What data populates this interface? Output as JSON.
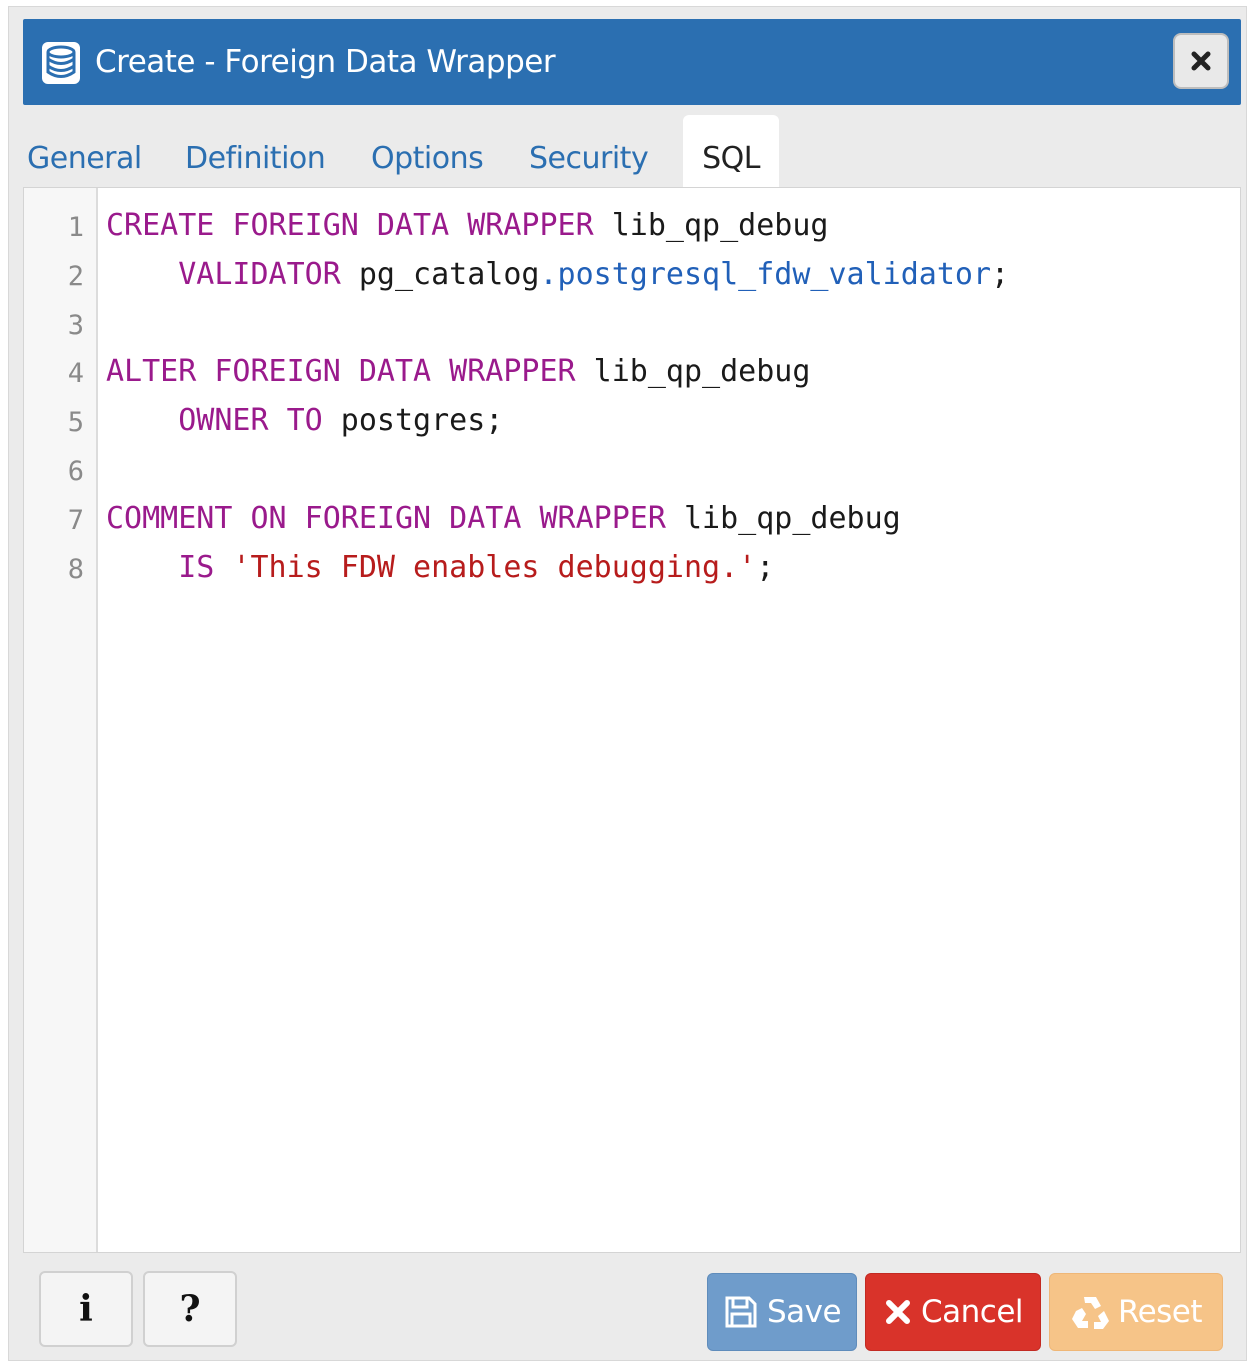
{
  "dialog": {
    "title": "Create - Foreign Data Wrapper",
    "title_icon": "database-icon",
    "close_icon": "close-icon"
  },
  "tabs": [
    {
      "label": "General",
      "active": false
    },
    {
      "label": "Definition",
      "active": false
    },
    {
      "label": "Options",
      "active": false
    },
    {
      "label": "Security",
      "active": false
    },
    {
      "label": "SQL",
      "active": true
    }
  ],
  "editor": {
    "line_numbers": [
      "1",
      "2",
      "3",
      "4",
      "5",
      "6",
      "7",
      "8"
    ],
    "lines": [
      [
        {
          "t": "CREATE FOREIGN DATA WRAPPER",
          "c": "kw"
        },
        {
          "t": " lib_qp_debug",
          "c": ""
        }
      ],
      [
        {
          "t": "    ",
          "c": ""
        },
        {
          "t": "VALIDATOR",
          "c": "kw"
        },
        {
          "t": " pg_catalog",
          "c": ""
        },
        {
          "t": ".postgresql_fdw_validator",
          "c": "fn"
        },
        {
          "t": ";",
          "c": ""
        }
      ],
      [],
      [
        {
          "t": "ALTER FOREIGN DATA WRAPPER",
          "c": "kw"
        },
        {
          "t": " lib_qp_debug",
          "c": ""
        }
      ],
      [
        {
          "t": "    ",
          "c": ""
        },
        {
          "t": "OWNER TO",
          "c": "kw"
        },
        {
          "t": " postgres;",
          "c": ""
        }
      ],
      [],
      [
        {
          "t": "COMMENT ON FOREIGN DATA WRAPPER",
          "c": "kw"
        },
        {
          "t": " lib_qp_debug",
          "c": ""
        }
      ],
      [
        {
          "t": "    ",
          "c": ""
        },
        {
          "t": "IS",
          "c": "kw"
        },
        {
          "t": " ",
          "c": ""
        },
        {
          "t": "'This FDW enables debugging.'",
          "c": "str"
        },
        {
          "t": ";",
          "c": ""
        }
      ]
    ]
  },
  "footer": {
    "info_label": "i",
    "help_label": "?",
    "save_label": "Save",
    "cancel_label": "Cancel",
    "reset_label": "Reset"
  },
  "colors": {
    "titlebar": "#2b6fb1",
    "keyword": "#9a1a8c",
    "function": "#2160b8",
    "string": "#b71c1c",
    "save": "#6f9ccb",
    "cancel": "#d9332a",
    "reset": "#f6c488"
  }
}
